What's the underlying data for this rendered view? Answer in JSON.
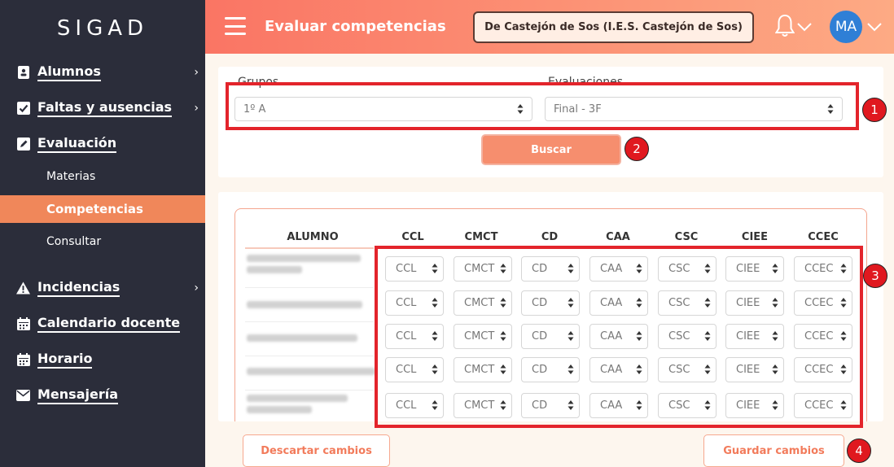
{
  "sidebar": {
    "logo": "SIGAD",
    "items": [
      {
        "label": "Alumnos",
        "icon": "id-card-icon",
        "chevron": "›"
      },
      {
        "label": "Faltas y ausencias",
        "icon": "checkbox-icon",
        "chevron": "›"
      },
      {
        "label": "Evaluación",
        "icon": "edit-icon"
      },
      {
        "label": "Incidencias",
        "icon": "warning-icon",
        "chevron": "›"
      },
      {
        "label": "Calendario docente",
        "icon": "calendar-icon"
      },
      {
        "label": "Horario",
        "icon": "calendar-icon"
      },
      {
        "label": "Mensajería",
        "icon": "envelope-icon"
      }
    ],
    "subitems": [
      {
        "label": "Materias"
      },
      {
        "label": "Competencias",
        "active": true
      },
      {
        "label": "Consultar"
      }
    ]
  },
  "header": {
    "title": "Evaluar competencias",
    "school": "De Castejón de Sos (I.E.S. Castejón de Sos)",
    "avatar_initials": "MA",
    "accent": "#fa7564",
    "avatar_color": "#2f7fd6"
  },
  "filters": {
    "group_label": "Grupos",
    "group_value": "1º A",
    "eval_label": "Evaluaciones",
    "eval_value": "Final - 3F",
    "search_button": "Buscar"
  },
  "table": {
    "headers": [
      "ALUMNO",
      "CCL",
      "CMCT",
      "CD",
      "CAA",
      "CSC",
      "CIEE",
      "CCEC"
    ],
    "rows": [
      [
        "CCL",
        "CMCT",
        "CD",
        "CAA",
        "CSC",
        "CIEE",
        "CCEC"
      ],
      [
        "CCL",
        "CMCT",
        "CD",
        "CAA",
        "CSC",
        "CIEE",
        "CCEC"
      ],
      [
        "CCL",
        "CMCT",
        "CD",
        "CAA",
        "CSC",
        "CIEE",
        "CCEC"
      ],
      [
        "CCL",
        "CMCT",
        "CD",
        "CAA",
        "CSC",
        "CIEE",
        "CCEC"
      ],
      [
        "CCL",
        "CMCT",
        "CD",
        "CAA",
        "CSC",
        "CIEE",
        "CCEC"
      ]
    ]
  },
  "footer": {
    "discard": "Descartar cambios",
    "save": "Guardar cambios"
  },
  "annotations": [
    "1",
    "2",
    "3",
    "4"
  ],
  "annotation_color": "#e3242b"
}
